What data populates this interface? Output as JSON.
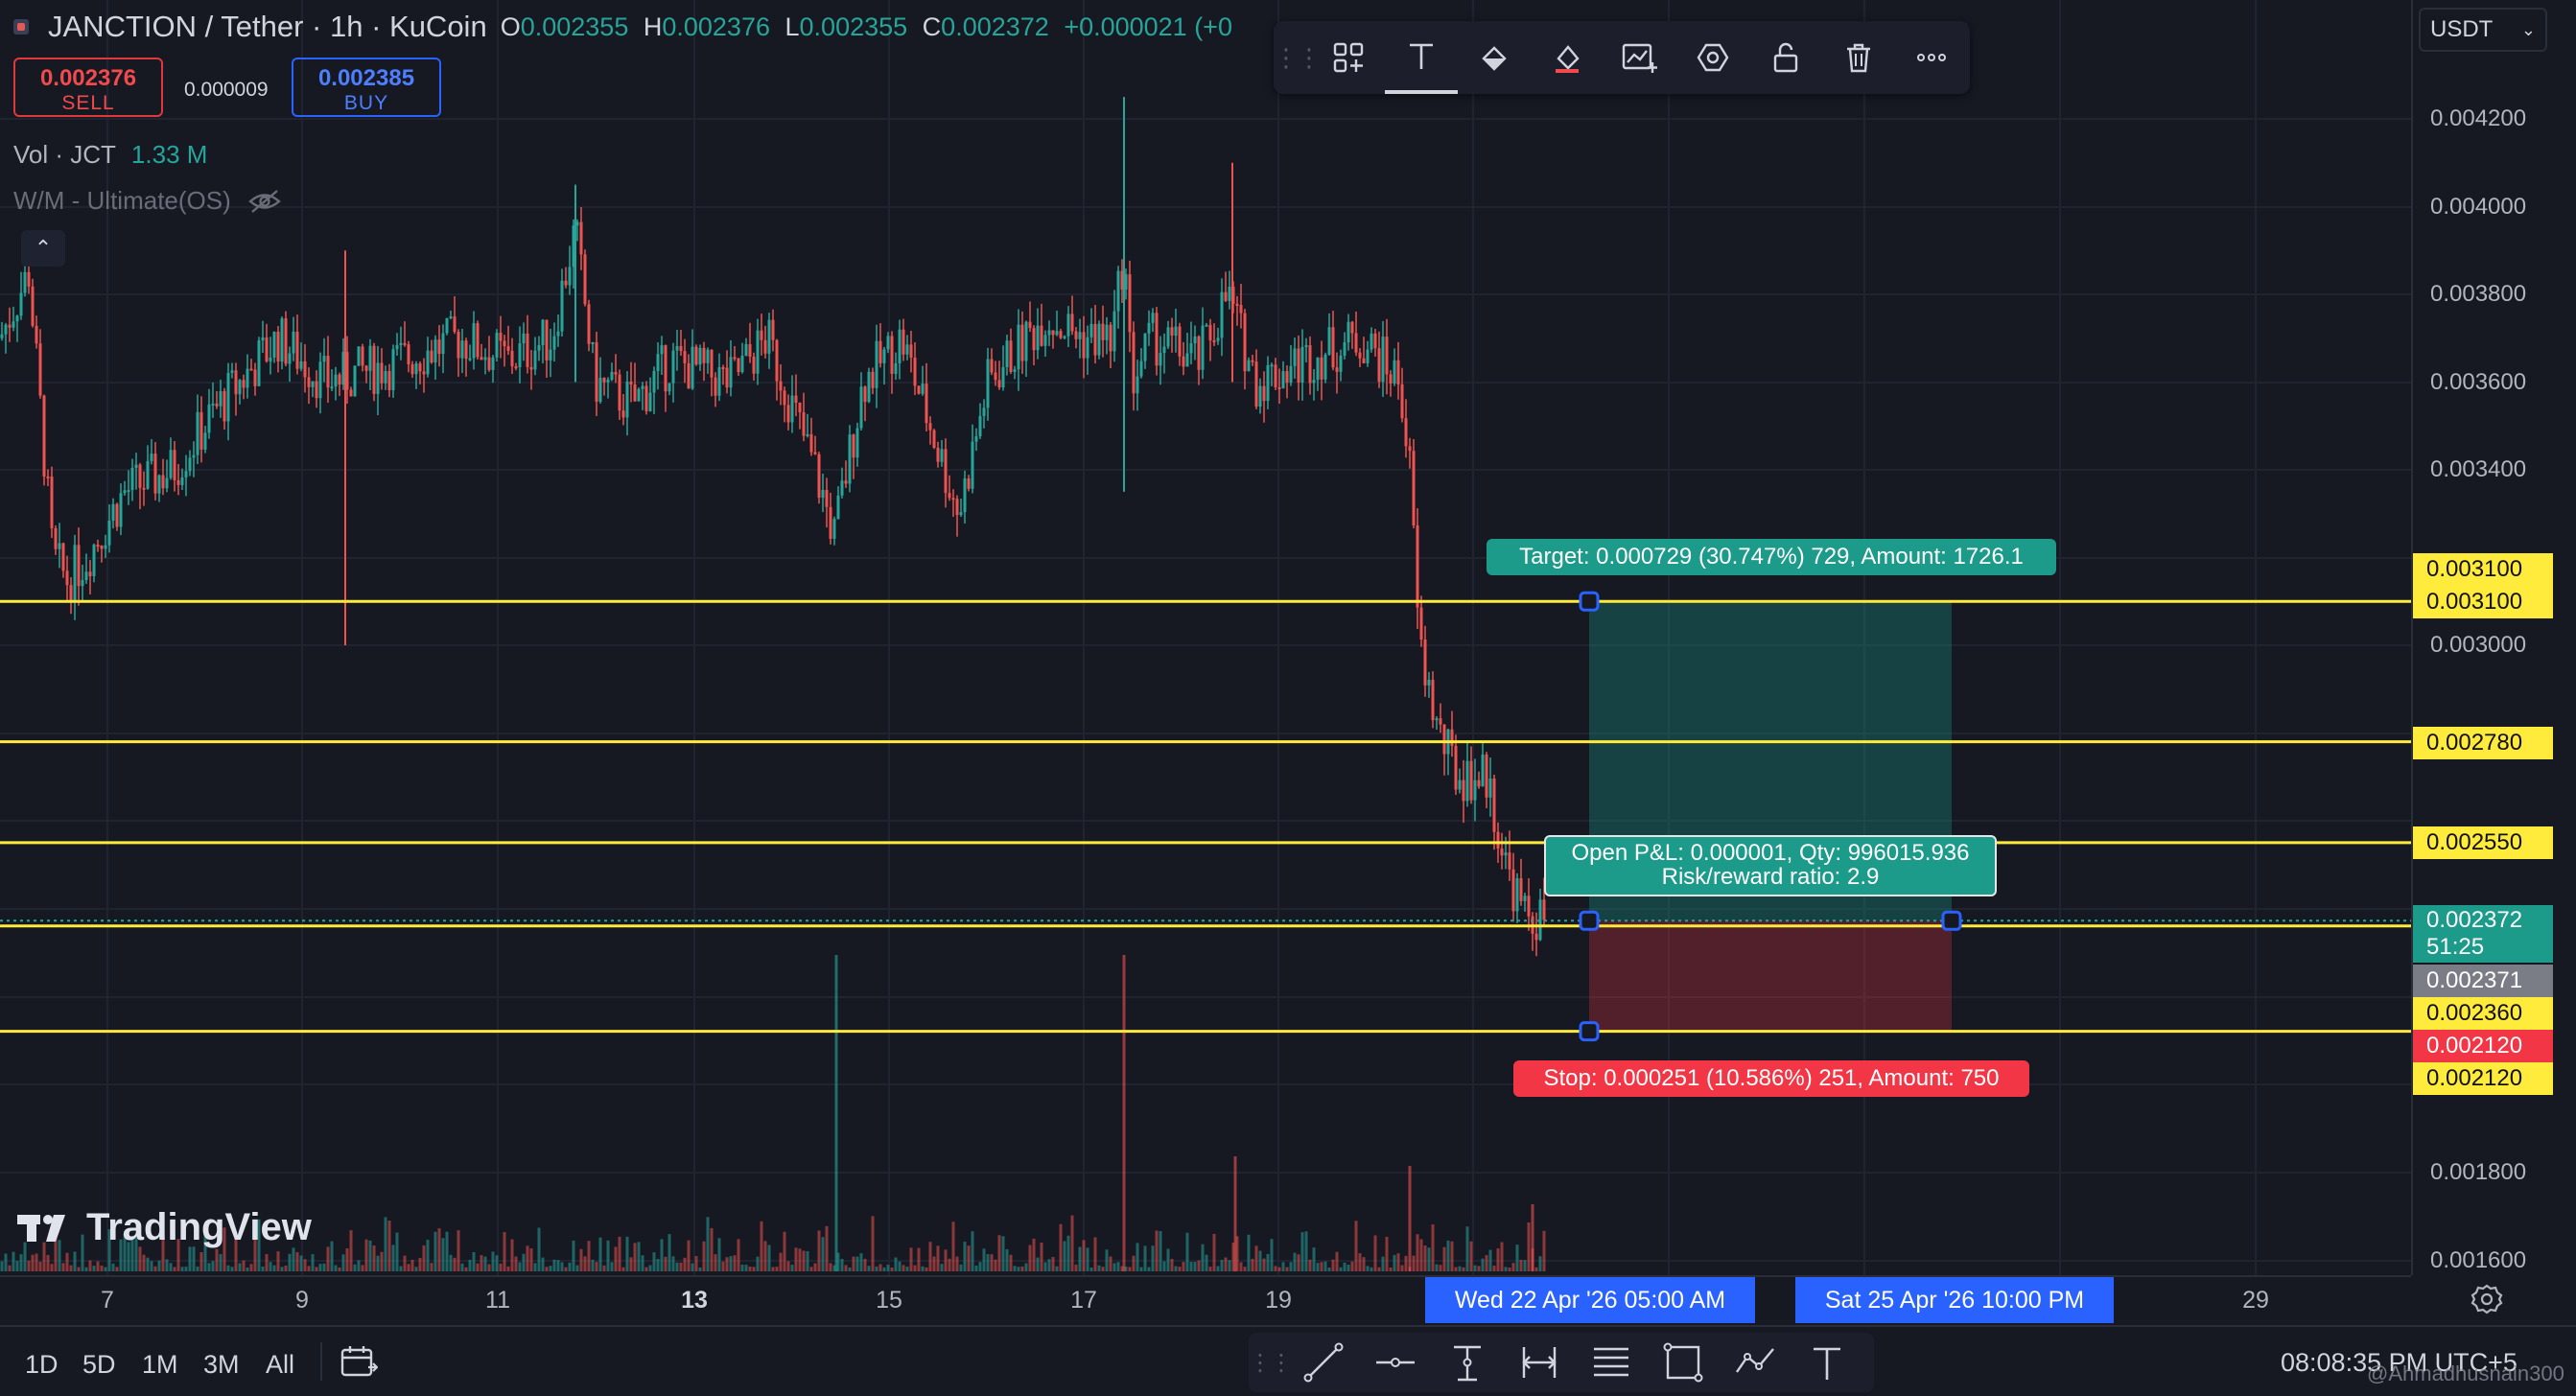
{
  "header": {
    "symbol_title": "JANCTION / Tether · 1h · KuCoin",
    "ohlc": [
      {
        "k": "O",
        "v": "0.002355"
      },
      {
        "k": "H",
        "v": "0.002376"
      },
      {
        "k": "L",
        "v": "0.002355"
      },
      {
        "k": "C",
        "v": "0.002372"
      },
      {
        "k": "",
        "v": "+0.000021 (+0"
      }
    ],
    "sell_price": "0.002376",
    "sell_label": "SELL",
    "spread": "0.000009",
    "buy_price": "0.002385",
    "buy_label": "BUY",
    "volume_label": "Vol · JCT",
    "volume_value": "1.33 M",
    "indicator_label": "W/M - Ultimate(OS)"
  },
  "currency_select": "USDT",
  "toolbar_icons": [
    "grid-plus-icon",
    "text-icon",
    "fill-icon",
    "brush-icon",
    "chart-settings-icon",
    "hexagon-icon",
    "unlock-icon",
    "trash-icon",
    "more-icon"
  ],
  "price_axis": {
    "ticks": [
      "0.004200",
      "0.004000",
      "0.003800",
      "0.003600",
      "0.003400",
      "0.003000",
      "0.001800",
      "0.001600"
    ],
    "labels": {
      "upper_3100": "0.003100",
      "target_3100": "0.003100",
      "line_2780": "0.002780",
      "line_2550": "0.002550",
      "last_price": "0.002372",
      "countdown": "51:25",
      "bid_2371": "0.002371",
      "line_2360": "0.002360",
      "stop_2120_red": "0.002120",
      "stop_2120": "0.002120"
    }
  },
  "time_axis": {
    "labels": [
      "7",
      "9",
      "11",
      "13",
      "15",
      "17",
      "19",
      "29"
    ],
    "bold_label": "13",
    "entry_time": "Wed 22 Apr '26   05:00 AM",
    "exit_time": "Sat 25 Apr '26   10:00 PM"
  },
  "position": {
    "target_text": "Target: 0.000729 (30.747%) 729, Amount: 1726.1",
    "pnl_line1": "Open P&L: 0.000001, Qty: 996015.936",
    "pnl_line2": "Risk/reward ratio: 2.9",
    "stop_text": "Stop: 0.000251 (10.586%) 251, Amount: 750",
    "entry_price": 0.002372,
    "target_price": 0.0031,
    "stop_price": 0.00212
  },
  "horizontal_lines": [
    0.0031,
    0.00278,
    0.00255,
    0.00236,
    0.00212
  ],
  "ranges": [
    "1D",
    "5D",
    "1M",
    "3M",
    "All"
  ],
  "drawing_tools": [
    "trendline-icon",
    "horizontal-ray-icon",
    "vertical-line-icon",
    "date-range-icon",
    "fib-retracement-icon",
    "rectangle-icon",
    "path-icon",
    "text-tool-icon"
  ],
  "brand": "TradingView",
  "clock": "08:08:35 PM UTC+5",
  "watermark": "@Ahmadhusnain300",
  "colors": {
    "up": "#26a69a",
    "down": "#ef5350",
    "line": "#ffeb3b",
    "profit": "#1c9a8a",
    "loss": "#f23645",
    "accent": "#2962ff"
  }
}
